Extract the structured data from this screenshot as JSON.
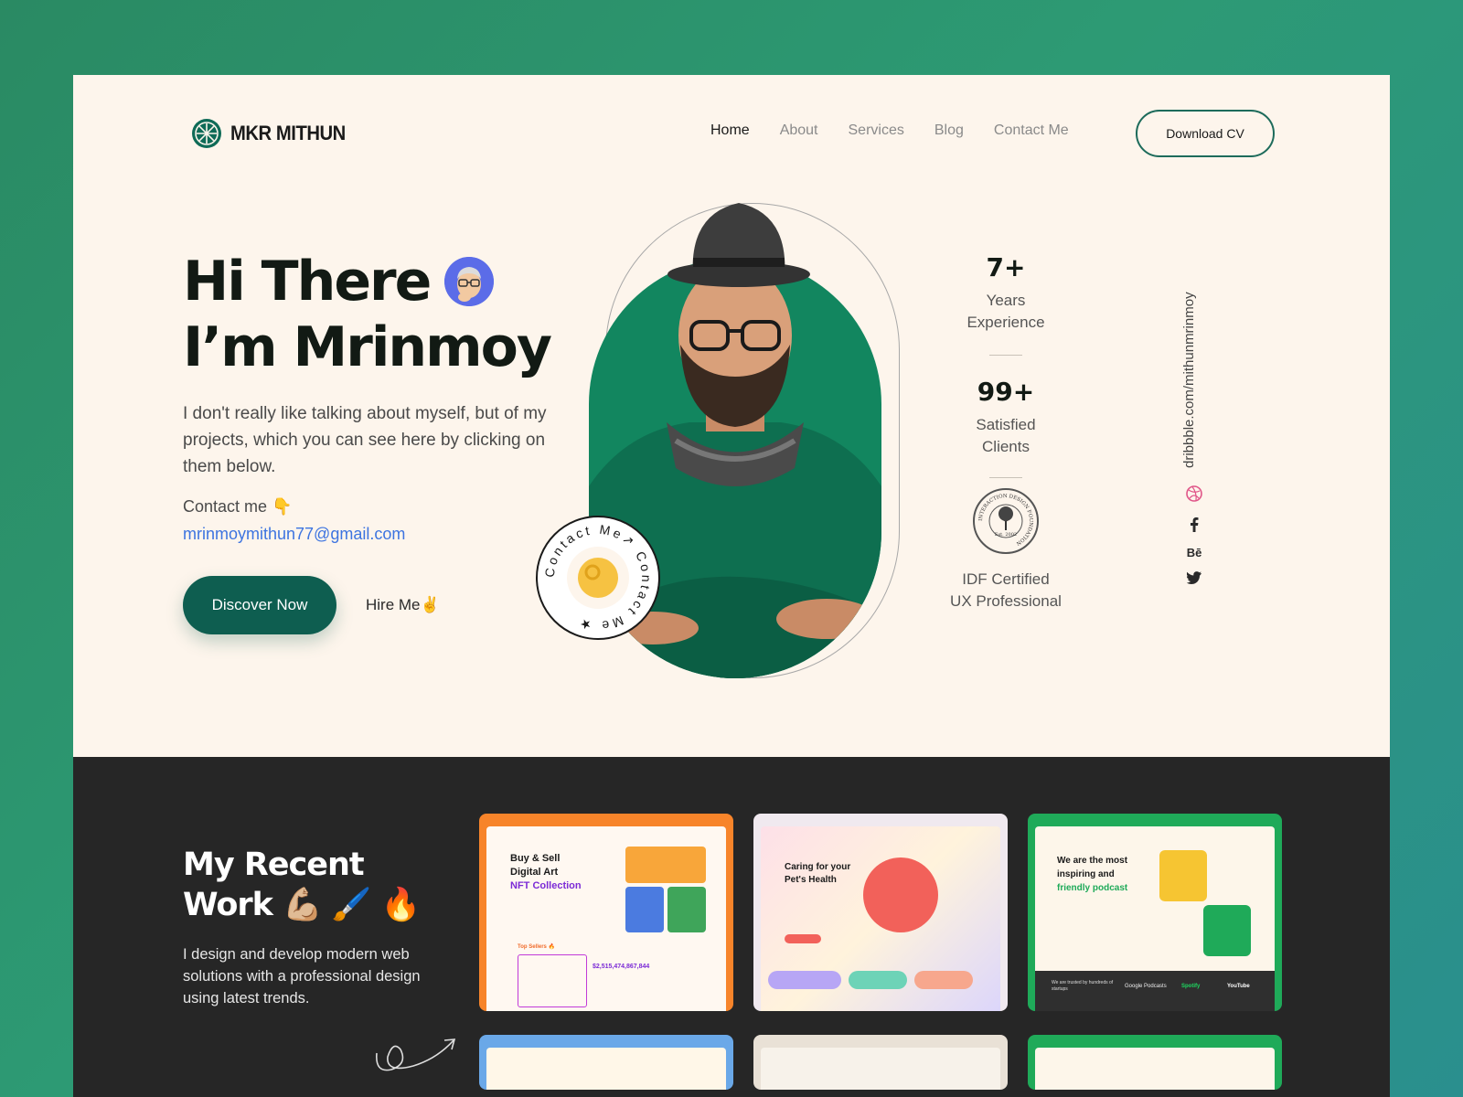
{
  "brand": {
    "name": "MKR MITHUN"
  },
  "nav": {
    "items": [
      {
        "label": "Home",
        "active": true
      },
      {
        "label": "About",
        "active": false
      },
      {
        "label": "Services",
        "active": false
      },
      {
        "label": "Blog",
        "active": false
      },
      {
        "label": "Contact Me",
        "active": false
      }
    ],
    "cta_label": "Download CV"
  },
  "hero": {
    "line1": "Hi There",
    "line2": "I’m Mrinmoy",
    "intro": "I don't really like talking about myself, but of my projects, which you can see here by clicking on them below.",
    "contact_label": "Contact me 👇",
    "email": "mrinmoymithun77@gmail.com",
    "primary_button": "Discover Now",
    "secondary_link": "Hire Me✌",
    "badge_text": "Contact Me↗ Contact Me ★"
  },
  "stats": [
    {
      "value": "7+",
      "label_line1": "Years",
      "label_line2": "Experience"
    },
    {
      "value": "99+",
      "label_line1": "Satisfied",
      "label_line2": "Clients"
    }
  ],
  "certification": {
    "seal_text": "INTERACTION DESIGN FOUNDATION",
    "seal_year": "Est. 2002",
    "label_line1": "IDF Certified",
    "label_line2": "UX Professional"
  },
  "social": {
    "url": "dribbble.com/mithunmrinmoy",
    "icons": [
      "dribbble-icon",
      "facebook-icon",
      "behance-icon",
      "twitter-icon"
    ],
    "behance_text": "Bē"
  },
  "recent_work": {
    "title_line1": "My Recent",
    "title_line2": "Work 💪🏼 🖌️ 🔥",
    "description": "I design and develop modern web solutions with a professional design using latest trends.",
    "cards": [
      {
        "heading_line1": "Buy & Sell",
        "heading_line2": "Digital Art",
        "heading_line3": "NFT Collection",
        "sub": "Top Sellers 🔥",
        "value": "$2,515,474,867,844",
        "accent": "#f7842a"
      },
      {
        "heading_line1": "Caring for your",
        "heading_line2": "Pet's Health",
        "accent": "#f6a9c4"
      },
      {
        "heading_line1": "We are the most",
        "heading_line2": "inspiring and",
        "heading_line3": "friendly podcast",
        "footer": "We are trusted by hundreds of startups",
        "logos": [
          "Google Podcasts",
          "Spotify",
          "YouTube"
        ],
        "accent": "#1faa59"
      }
    ]
  },
  "colors": {
    "background_green": "#2a8a63",
    "hero_bg": "#fdf5ec",
    "primary": "#0e5e50",
    "photo_green": "#12865f",
    "dark_section": "#262626",
    "link_blue": "#3d74e0"
  }
}
